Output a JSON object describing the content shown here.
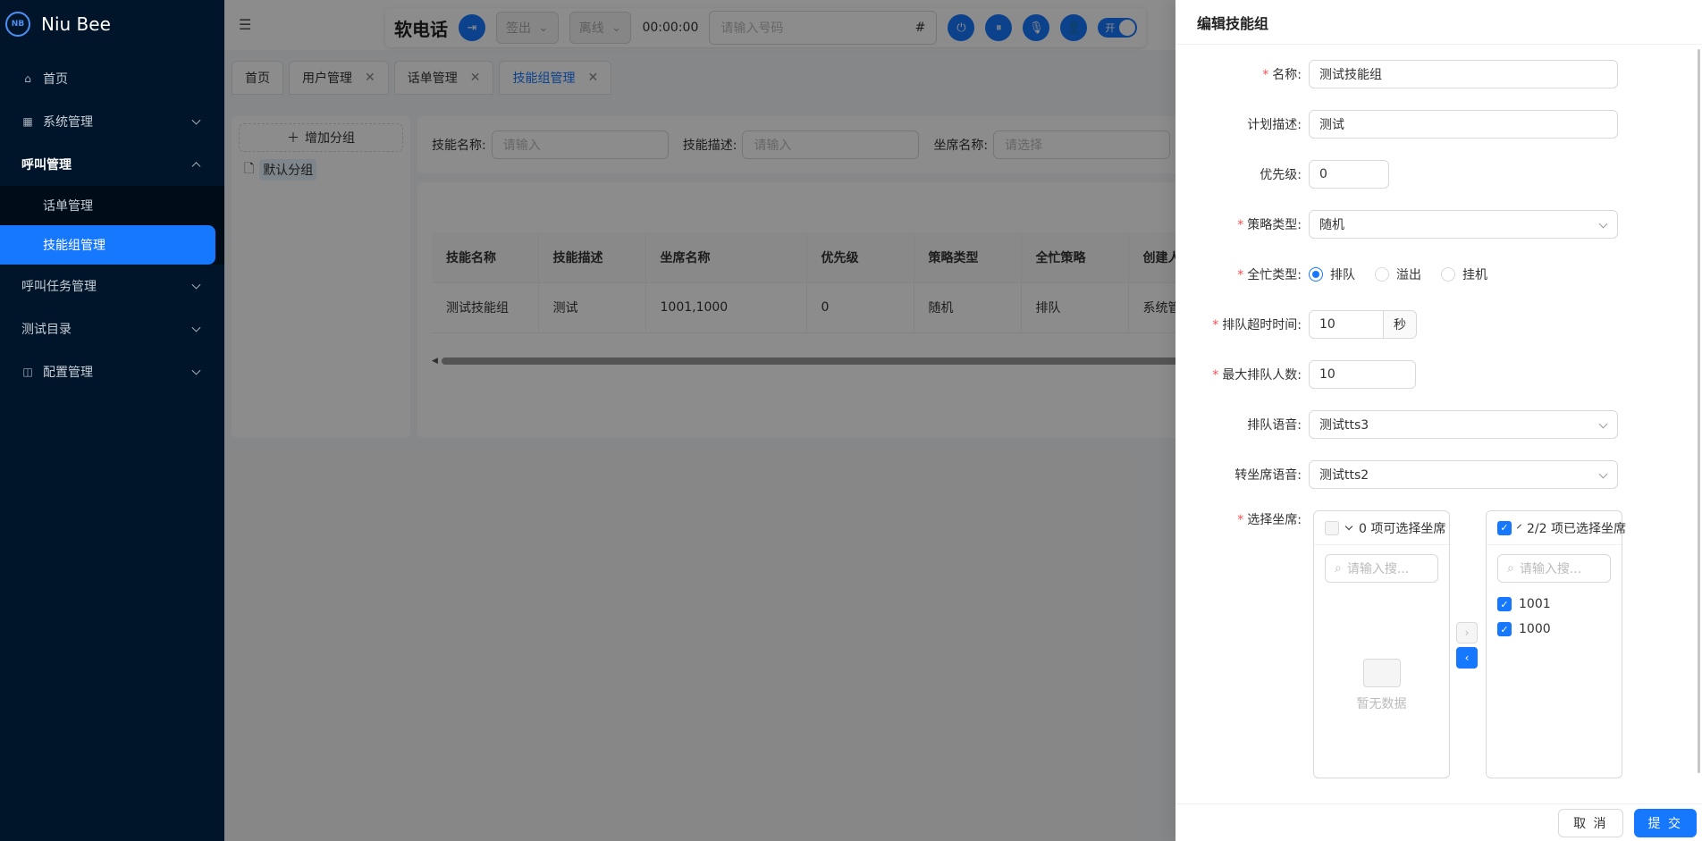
{
  "app": {
    "logo_mark": "NB",
    "name": "Niu Bee"
  },
  "sidebar": {
    "items": [
      {
        "label": "首页",
        "icon": "home-icon"
      },
      {
        "label": "系统管理",
        "icon": "grid-icon"
      },
      {
        "label": "呼叫管理"
      },
      {
        "label": "话单管理"
      },
      {
        "label": "技能组管理"
      },
      {
        "label": "呼叫任务管理"
      },
      {
        "label": "测试目录"
      },
      {
        "label": "配置管理",
        "icon": "config-icon"
      }
    ]
  },
  "phonebar": {
    "title": "软电话",
    "checkout": "签出",
    "status": "离线",
    "timer": "00:00:00",
    "number_placeholder": "请输入号码",
    "hash": "#",
    "toggle": "开"
  },
  "tabs": [
    {
      "label": "首页"
    },
    {
      "label": "用户管理"
    },
    {
      "label": "话单管理"
    },
    {
      "label": "技能组管理"
    }
  ],
  "groups": {
    "add_label": "增加分组",
    "items": [
      "默认分组"
    ]
  },
  "filters": {
    "skill_name_label": "技能名称:",
    "skill_name_placeholder": "请输入",
    "skill_desc_label": "技能描述:",
    "skill_desc_placeholder": "请输入",
    "seat_label": "坐席名称:",
    "seat_placeholder": "请选择"
  },
  "table": {
    "headers": [
      "技能名称",
      "技能描述",
      "坐席名称",
      "优先级",
      "策略类型",
      "全忙策略",
      "创建人"
    ],
    "rows": [
      [
        "测试技能组",
        "测试",
        "1001,1000",
        "0",
        "随机",
        "排队",
        "系统管"
      ]
    ]
  },
  "drawer": {
    "title": "编辑技能组",
    "fields": {
      "name_label": "名称:",
      "name_value": "测试技能组",
      "desc_label": "计划描述:",
      "desc_value": "测试",
      "priority_label": "优先级:",
      "priority_value": "0",
      "strategy_label": "策略类型:",
      "strategy_value": "随机",
      "busy_label": "全忙类型:",
      "busy_options": [
        "排队",
        "溢出",
        "挂机"
      ],
      "busy_selected": "排队",
      "timeout_label": "排队超时时间:",
      "timeout_value": "10",
      "timeout_unit": "秒",
      "max_queue_label": "最大排队人数:",
      "max_queue_value": "10",
      "queue_voice_label": "排队语音:",
      "queue_voice_value": "测试tts3",
      "transfer_voice_label": "转坐席语音:",
      "transfer_voice_value": "测试tts2",
      "seat_label": "选择坐席:"
    },
    "transfer": {
      "left_header": "0 项可选择坐席",
      "right_header": "2/2 项已选择坐席",
      "search_placeholder": "请输入搜...",
      "empty_text": "暂无数据",
      "selected_items": [
        "1001",
        "1000"
      ]
    },
    "footer": {
      "cancel": "取 消",
      "submit": "提 交"
    }
  },
  "colors": {
    "primary": "#1677ff",
    "sidebar_bg": "#001529",
    "required": "#ff4d4f"
  }
}
